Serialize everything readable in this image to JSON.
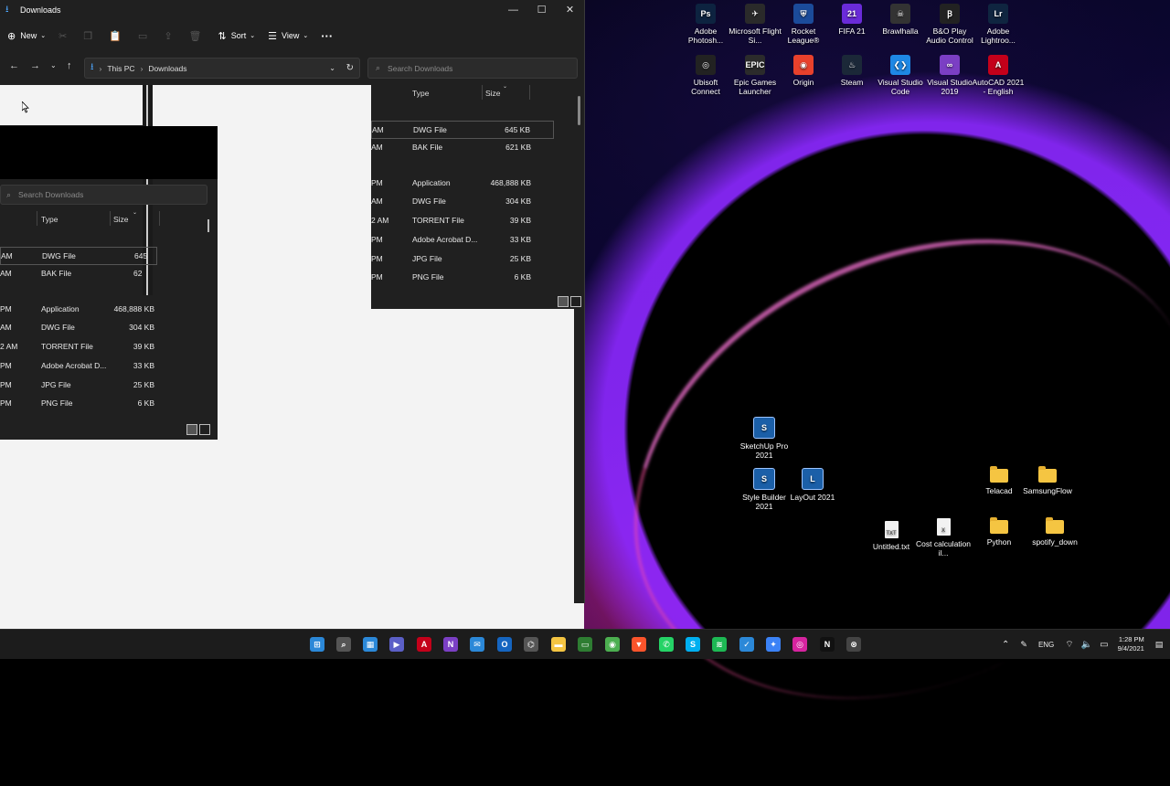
{
  "desktop": {
    "icons_top": [
      {
        "label": "Adobe Photosh...",
        "color": "#0d2340",
        "glyph": "Ps"
      },
      {
        "label": "Microsoft Flight Si...",
        "color": "#2a2a2a",
        "glyph": "✈"
      },
      {
        "label": "Rocket League®",
        "color": "#1b4b9a",
        "glyph": "⛨"
      },
      {
        "label": "FIFA 21",
        "color": "#6a2bd9",
        "glyph": "21"
      },
      {
        "label": "Brawlhalla",
        "color": "#333333",
        "glyph": "☠"
      },
      {
        "label": "B&O Play Audio Control",
        "color": "#222222",
        "glyph": "Ꞵ"
      },
      {
        "label": "Adobe Lightroo...",
        "color": "#0f2540",
        "glyph": "Lr"
      }
    ],
    "icons_second": [
      {
        "label": "Ubisoft Connect",
        "color": "#222222",
        "glyph": "◎"
      },
      {
        "label": "Epic Games Launcher",
        "color": "#2b2b2b",
        "glyph": "EPIC"
      },
      {
        "label": "Origin",
        "color": "#e8412c",
        "glyph": "◉"
      },
      {
        "label": "Steam",
        "color": "#1b2838",
        "glyph": "♨"
      },
      {
        "label": "Visual Studio Code",
        "color": "#1e88e5",
        "glyph": "❮❯"
      },
      {
        "label": "Visual Studio 2019",
        "color": "#7b3fc4",
        "glyph": "∞"
      },
      {
        "label": "AutoCAD 2021 - English",
        "color": "#c4001a",
        "glyph": "A"
      }
    ],
    "icons_lower": [
      {
        "label": "SketchUp Pro 2021",
        "color": "#1b5fa8",
        "glyph": "S"
      },
      {
        "label": "Style Builder 2021",
        "color": "#1b5fa8",
        "glyph": "S"
      },
      {
        "label": "LayOut 2021",
        "color": "#1b5fa8",
        "glyph": "L"
      },
      {
        "label": "Untitled.txt",
        "glyph": "TXT"
      },
      {
        "label": "Cost calculation il...",
        "glyph": "X"
      },
      {
        "label": "Telacad"
      },
      {
        "label": "SamsungFlow"
      },
      {
        "label": "Python"
      },
      {
        "label": "spotify_down"
      }
    ]
  },
  "explorer": {
    "title": "Downloads",
    "window_controls": [
      "—",
      "☐",
      "✕"
    ],
    "commands": {
      "new": "New",
      "sort": "Sort",
      "view": "View",
      "more": "···"
    },
    "breadcrumb": {
      "root": "This PC",
      "sep": "›",
      "current": "Downloads"
    },
    "search_placeholder": "Search Downloads",
    "columns": {
      "type": "Type",
      "size": "Size"
    },
    "rows": [
      {
        "time": "AM",
        "type": "DWG File",
        "size": "645 KB"
      },
      {
        "time": "AM",
        "type": "BAK File",
        "size": "621 KB"
      },
      {
        "time": "PM",
        "type": "Application",
        "size": "468,888 KB"
      },
      {
        "time": "AM",
        "type": "DWG File",
        "size": "304 KB"
      },
      {
        "time": "2 AM",
        "type": "TORRENT File",
        "size": "39 KB"
      },
      {
        "time": "PM",
        "type": "Adobe Acrobat D...",
        "size": "33 KB"
      },
      {
        "time": "PM",
        "type": "JPG File",
        "size": "25 KB"
      },
      {
        "time": "PM",
        "type": "PNG File",
        "size": "6 KB"
      }
    ],
    "ghost_size_row1": "645",
    "ghost_size_row2": "62"
  },
  "taskbar": {
    "apps": [
      {
        "name": "start",
        "color": "#2b88d8",
        "glyph": "⊞"
      },
      {
        "name": "search",
        "color": "#555555",
        "glyph": "⌕"
      },
      {
        "name": "widgets",
        "color": "#2b88d8",
        "glyph": "▦"
      },
      {
        "name": "teams",
        "color": "#5b5fc7",
        "glyph": "▶"
      },
      {
        "name": "acrobat",
        "color": "#c4001a",
        "glyph": "A"
      },
      {
        "name": "onenote",
        "color": "#7b3fc4",
        "glyph": "N"
      },
      {
        "name": "mail",
        "color": "#2b88d8",
        "glyph": "✉"
      },
      {
        "name": "outlook",
        "color": "#1565c0",
        "glyph": "O"
      },
      {
        "name": "network",
        "color": "#555555",
        "glyph": "⌬"
      },
      {
        "name": "file-explorer",
        "color": "#f5c542",
        "glyph": "▬"
      },
      {
        "name": "maps",
        "color": "#2e7d32",
        "glyph": "▭"
      },
      {
        "name": "chrome",
        "color": "#4caf50",
        "glyph": "◉"
      },
      {
        "name": "brave",
        "color": "#fb542b",
        "glyph": "▼"
      },
      {
        "name": "whatsapp",
        "color": "#25d366",
        "glyph": "✆"
      },
      {
        "name": "skype",
        "color": "#00aff0",
        "glyph": "S"
      },
      {
        "name": "spotify",
        "color": "#1db954",
        "glyph": "≋"
      },
      {
        "name": "todo",
        "color": "#2b88d8",
        "glyph": "✓"
      },
      {
        "name": "messenger",
        "color": "#3b82f6",
        "glyph": "✦"
      },
      {
        "name": "instagram",
        "color": "#d6249f",
        "glyph": "◎"
      },
      {
        "name": "netflix",
        "color": "#111111",
        "glyph": "N"
      },
      {
        "name": "xbox",
        "color": "#444444",
        "glyph": "⊗"
      }
    ],
    "tray": {
      "chevron": "⌃",
      "lang": "ENG",
      "time": "1:28 PM",
      "date": "9/4/2021"
    }
  }
}
